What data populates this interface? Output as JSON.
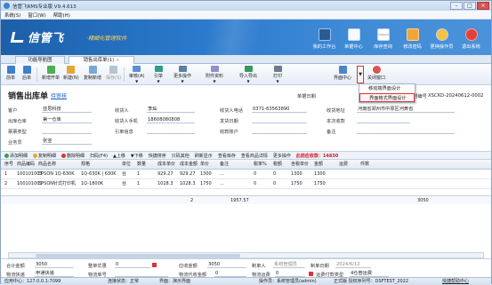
{
  "window": {
    "title": "信管飞RMS专业版 V9.4.613"
  },
  "menu": [
    "系统(S)",
    "窗口(W)",
    "帮助(H)"
  ],
  "brand": {
    "name": "信管飞",
    "slogan": "·精细化管理软件"
  },
  "topbuttons": [
    "我的工作台",
    "单据中心",
    "库存查询",
    "修改密码",
    "更换操作员",
    "退出系统"
  ],
  "tabs": [
    "功能导航图",
    "销售出库单(1)"
  ],
  "toolbar": [
    "前单",
    "后单",
    "新增开单",
    "新建(N)",
    "复制新增",
    "保存(S)",
    "审核(A)",
    "引单",
    "更多操作",
    "附件资料",
    "导入导出",
    "打印",
    "界面中心",
    "关闭窗口"
  ],
  "dropdown": [
    "移动端界面设计",
    "界面格式界面设计"
  ],
  "doc": {
    "title": "销售出库单",
    "state": "待审核",
    "docno_label": "单据编号",
    "docno": "XSCKD-20240612-0002",
    "date_label": "单据日期"
  },
  "fields": {
    "customer_l": "客户",
    "customer": "亚思科技",
    "warehouse_l": "出库仓库",
    "warehouse": "第一仓库",
    "billtype_l": "票票类型",
    "billtype": "",
    "salesman_l": "业务员",
    "salesman": "张亚",
    "receiver_l": "收货人",
    "receiver": "李灿",
    "receiverphone_l": "收货人手机",
    "receiverphone": "18608080808",
    "refdoc_l": "引单信息",
    "refdoc": "",
    "tel_l": "收货人电话",
    "tel": "0371-63563890",
    "ship_l": "发货日期",
    "ship": "",
    "acct_l": "收款账户",
    "acct": "",
    "addr_l": "收货地址",
    "addr": "河南省郑州市中原区河黄省",
    "times_l": "本次收款",
    "times": "",
    "note_l": "备注",
    "note": ""
  },
  "gridtoolbar": [
    "添加明细",
    "复制明细",
    "删除明细",
    "扫码(F4)",
    "上移",
    "下移",
    "快捷排序",
    "只码其他",
    "刷新显示",
    "查看库存",
    "查看商品详情",
    "更多操作",
    "此前应收款：14830"
  ],
  "columns": [
    "序号",
    "商品编码",
    "商品名称",
    "规格",
    "单位",
    "数量",
    "成本单价",
    "成本金额",
    "单价",
    "备注",
    "税率%",
    "税额",
    "含税单价",
    "金额",
    "运费",
    "件数"
  ],
  "rows": [
    [
      "1",
      "100101001",
      "EPSON 1Q-630K",
      "1Q-630K | 630K",
      "台",
      "1",
      "929.27",
      "929.27",
      "1300",
      "...",
      "0",
      "0",
      "1300",
      "1300",
      "",
      ""
    ],
    [
      "2",
      "100101002",
      "EPSON针式打印机",
      "1Q-1800K",
      "台",
      "1",
      "1028.3",
      "1028.3",
      "1750",
      "...",
      "0",
      "0",
      "1750",
      "1750",
      "",
      ""
    ]
  ],
  "sum": {
    "qty": "2",
    "cost": "1957.57",
    "amount": "3050"
  },
  "foot": {
    "total_l": "合计金额",
    "total": "3050",
    "discount_l": "整单优惠",
    "discount": "0",
    "due_l": "应收金额",
    "due": "3050",
    "maker_l": "制单人",
    "maker": "系统管理员",
    "date_l": "制单日期",
    "date": "2024/6/12",
    "carrier_l": "物流快递",
    "carrier": "申通快递",
    "waybill_l": "物流单号",
    "waybill": "",
    "collect_l": "物流代收金额",
    "collect": "0",
    "freight_l": "物流运费",
    "freight": "0",
    "paytype_l": "运费付款类型",
    "paytype": "4仓管运费"
  },
  "status": {
    "app": "应用中心：127.0.0.1:7099",
    "conn": "连接状态：正常",
    "theme": "界面：演示界面",
    "op": "操作员：系统管理员(admin)",
    "ver": "正式版 授权序列号：DSFTEST_2022",
    "help": "快捷帮助中心"
  },
  "colors": {
    "banner": "#2a79cc",
    "accent": "#d33"
  }
}
